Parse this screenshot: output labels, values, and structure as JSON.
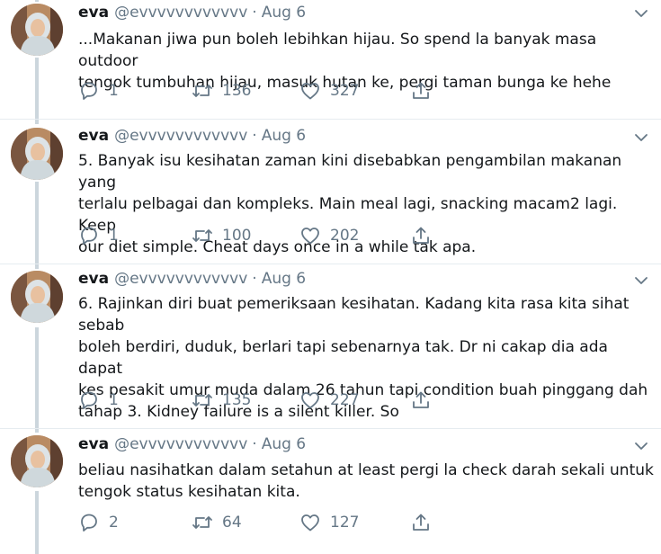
{
  "tweets": [
    {
      "name": "eva",
      "handle": "@evvvvvvvvvvvv",
      "separator": "·",
      "date": "Aug 6",
      "text": "...Makanan jiwa pun boleh lebihkan hijau. So spend la banyak masa outdoor\ntengok tumbuhan hijau, masuk hutan ke, pergi taman bunga ke hehe",
      "replies": "1",
      "retweets": "136",
      "likes": "327"
    },
    {
      "name": "eva",
      "handle": "@evvvvvvvvvvvv",
      "separator": "·",
      "date": "Aug 6",
      "text": "5. Banyak isu kesihatan zaman kini disebabkan pengambilan makanan yang\nterlalu pelbagai dan kompleks. Main meal lagi, snacking macam2 lagi. Keep\nour diet simple. Cheat days once in a while tak apa.",
      "replies": "1",
      "retweets": "100",
      "likes": "202"
    },
    {
      "name": "eva",
      "handle": "@evvvvvvvvvvvv",
      "separator": "·",
      "date": "Aug 6",
      "text": "6. Rajinkan diri buat pemeriksaan kesihatan. Kadang kita rasa kita sihat sebab\nboleh berdiri, duduk, berlari tapi sebenarnya tak. Dr ni cakap dia ada dapat\nkes pesakit umur muda dalam 26 tahun tapi condition buah pinggang dah\ntahap 3. Kidney failure is a silent killer. So",
      "replies": "1",
      "retweets": "135",
      "likes": "227"
    },
    {
      "name": "eva",
      "handle": "@evvvvvvvvvvvv",
      "separator": "·",
      "date": "Aug 6",
      "text": "beliau nasihatkan dalam setahun at least pergi la check darah sekali untuk\ntengok status kesihatan kita.",
      "replies": "2",
      "retweets": "64",
      "likes": "127"
    }
  ],
  "icons": {
    "caret": "chevron-down-icon",
    "reply": "reply-icon",
    "retweet": "retweet-icon",
    "like": "heart-icon",
    "share": "share-icon"
  },
  "colors": {
    "text": "#14171a",
    "secondary": "#657786",
    "thread_line": "#ccd6dd",
    "divider": "#e6ecf0"
  }
}
